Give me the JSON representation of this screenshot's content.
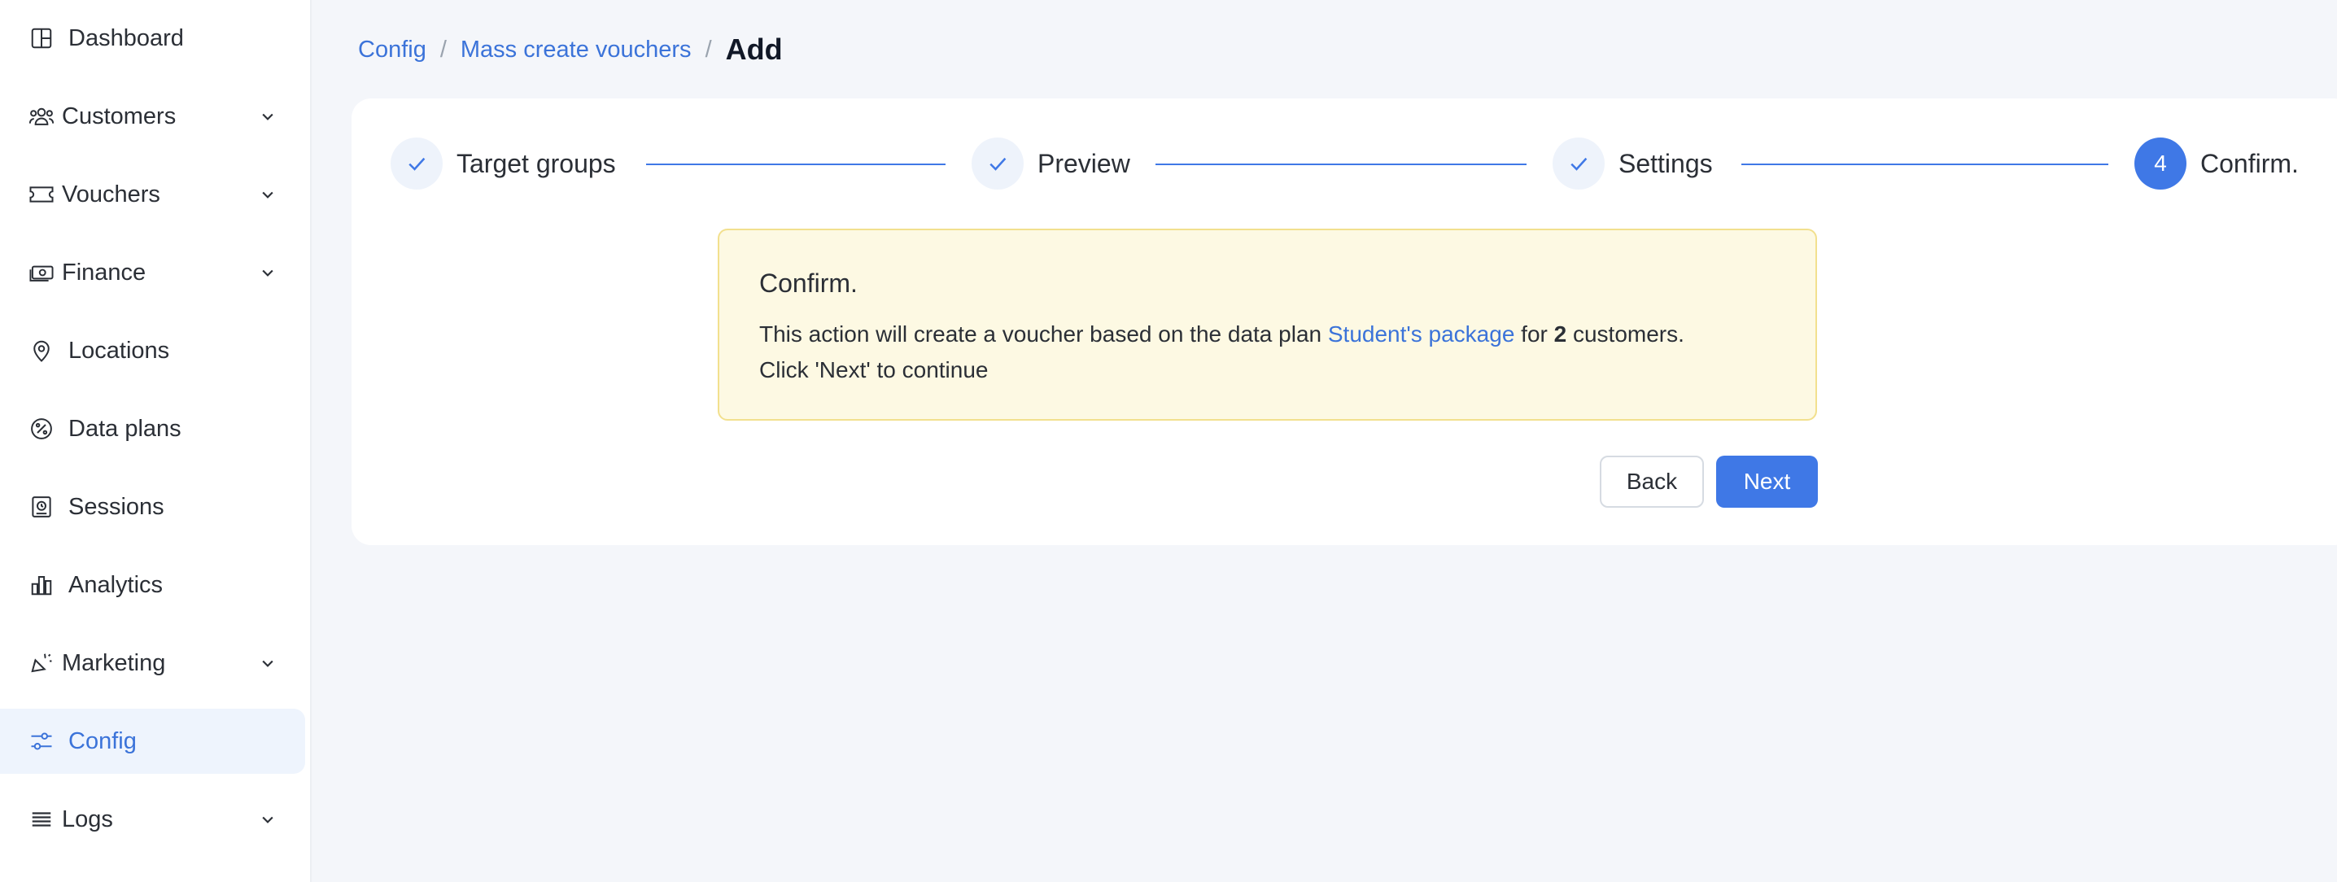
{
  "sidebar": {
    "items": [
      {
        "label": "Dashboard",
        "icon": "dashboard-icon",
        "has_chevron": false
      },
      {
        "label": "Customers",
        "icon": "customers-icon",
        "has_chevron": true
      },
      {
        "label": "Vouchers",
        "icon": "voucher-icon",
        "has_chevron": true
      },
      {
        "label": "Finance",
        "icon": "finance-icon",
        "has_chevron": true
      },
      {
        "label": "Locations",
        "icon": "location-pin-icon",
        "has_chevron": false
      },
      {
        "label": "Data plans",
        "icon": "data-plans-icon",
        "has_chevron": false
      },
      {
        "label": "Sessions",
        "icon": "sessions-icon",
        "has_chevron": false
      },
      {
        "label": "Analytics",
        "icon": "analytics-icon",
        "has_chevron": false
      },
      {
        "label": "Marketing",
        "icon": "marketing-icon",
        "has_chevron": true
      },
      {
        "label": "Config",
        "icon": "config-sliders-icon",
        "has_chevron": false,
        "active": true
      },
      {
        "label": "Logs",
        "icon": "logs-list-icon",
        "has_chevron": true
      }
    ]
  },
  "breadcrumb": {
    "items": [
      "Config",
      "Mass create vouchers"
    ],
    "separator": "/",
    "current": "Add"
  },
  "stepper": {
    "steps": [
      {
        "label": "Target groups",
        "state": "done"
      },
      {
        "label": "Preview",
        "state": "done"
      },
      {
        "label": "Settings",
        "state": "done"
      },
      {
        "label": "Confirm.",
        "state": "current",
        "number": "4"
      }
    ]
  },
  "alert": {
    "title": "Confirm.",
    "text_before": "This action will create a voucher based on the data plan ",
    "plan_link": "Student's package",
    "text_mid": " for ",
    "count": "2",
    "text_after": " customers.",
    "line2": "Click 'Next' to continue"
  },
  "actions": {
    "back_label": "Back",
    "next_label": "Next"
  },
  "colors": {
    "accent": "#3f78e6",
    "link": "#3b73d9",
    "alert_bg": "#fdf9e3",
    "alert_border": "#f2e08e",
    "active_bg": "#eef4fd"
  }
}
